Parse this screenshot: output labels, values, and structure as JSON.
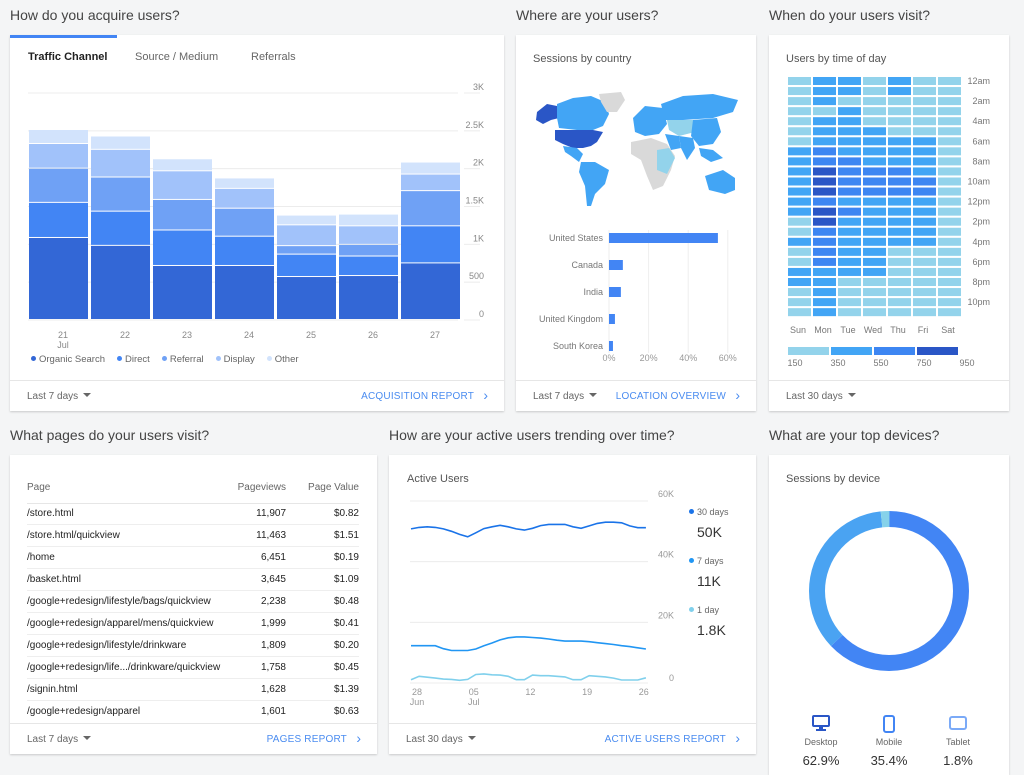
{
  "sections": {
    "acquire": "How do you acquire users?",
    "where": "Where are your users?",
    "when": "When do your users visit?",
    "pages": "What pages do your users visit?",
    "active": "How are your active users trending over time?",
    "devices": "What are your top devices?"
  },
  "acquisition": {
    "tabs": [
      "Traffic Channel",
      "Source / Medium",
      "Referrals"
    ],
    "active_tab": "Traffic Channel",
    "range": "Last 7 days",
    "link": "ACQUISITION REPORT"
  },
  "location": {
    "subtitle": "Sessions by country",
    "range": "Last 7 days",
    "link": "LOCATION OVERVIEW"
  },
  "time": {
    "subtitle": "Users by time of day",
    "range": "Last 30 days"
  },
  "pages": {
    "headers": [
      "Page",
      "Pageviews",
      "Page Value"
    ],
    "rows": [
      [
        "/store.html",
        "11,907",
        "$0.82"
      ],
      [
        "/store.html/quickview",
        "11,463",
        "$1.51"
      ],
      [
        "/home",
        "6,451",
        "$0.19"
      ],
      [
        "/basket.html",
        "3,645",
        "$1.09"
      ],
      [
        "/google+redesign/lifestyle/bags/quickview",
        "2,238",
        "$0.48"
      ],
      [
        "/google+redesign/apparel/mens/quickview",
        "1,999",
        "$0.41"
      ],
      [
        "/google+redesign/lifestyle/drinkware",
        "1,809",
        "$0.20"
      ],
      [
        "/google+redesign/life.../drinkware/quickview",
        "1,758",
        "$0.45"
      ],
      [
        "/signin.html",
        "1,628",
        "$1.39"
      ],
      [
        "/google+redesign/apparel",
        "1,601",
        "$0.63"
      ]
    ],
    "range": "Last 7 days",
    "link": "PAGES REPORT"
  },
  "active": {
    "subtitle": "Active Users",
    "range": "Last 30 days",
    "link": "ACTIVE USERS REPORT",
    "legend": [
      {
        "label": "30 days",
        "value": "50K",
        "color": "#1a73e8"
      },
      {
        "label": "7 days",
        "value": "11K",
        "color": "#2196f3"
      },
      {
        "label": "1 day",
        "value": "1.8K",
        "color": "#80d0ec"
      }
    ]
  },
  "devices": {
    "subtitle": "Sessions by device",
    "items": [
      {
        "label": "Desktop",
        "value": "62.9%",
        "pct": 62.9,
        "color": "#4285f4",
        "icon": "desktop-icon"
      },
      {
        "label": "Mobile",
        "value": "35.4%",
        "pct": 35.4,
        "color": "#4aa3f2",
        "icon": "mobile-icon"
      },
      {
        "label": "Tablet",
        "value": "1.8%",
        "pct": 1.8,
        "color": "#86d2ea",
        "icon": "tablet-icon"
      }
    ]
  },
  "chart_data": [
    {
      "type": "bar",
      "stacked": true,
      "categories": [
        "21",
        "22",
        "23",
        "24",
        "25",
        "26",
        "27"
      ],
      "category_sublabel": "Jul",
      "ylim": [
        0,
        3000
      ],
      "yticks": [
        "0",
        "500",
        "1K",
        "1.5K",
        "2K",
        "2.5K",
        "3K"
      ],
      "grid": true,
      "legend": "bottom",
      "series": [
        {
          "name": "Organic Search",
          "color": "#3367d6",
          "values": [
            1084,
            980,
            714,
            714,
            568,
            581,
            748
          ]
        },
        {
          "name": "Direct",
          "color": "#4285f4",
          "values": [
            464,
            452,
            469,
            387,
            296,
            258,
            490
          ]
        },
        {
          "name": "Referral",
          "color": "#6fa1f5",
          "values": [
            452,
            451,
            404,
            370,
            112,
            154,
            465
          ]
        },
        {
          "name": "Display",
          "color": "#a1c2fa",
          "values": [
            326,
            366,
            378,
            262,
            275,
            245,
            219
          ]
        },
        {
          "name": "Other",
          "color": "#d2e3fc",
          "values": [
            185,
            176,
            159,
            138,
            129,
            155,
            159
          ]
        }
      ]
    },
    {
      "type": "bar",
      "orientation": "horizontal",
      "categories": [
        "United States",
        "Canada",
        "India",
        "United Kingdom",
        "South Korea"
      ],
      "values": [
        55,
        7,
        6,
        3,
        2
      ],
      "xlim": [
        0,
        60
      ],
      "xticks": [
        "0%",
        "20%",
        "40%",
        "60%"
      ],
      "color": "#4285f4"
    },
    {
      "type": "heatmap",
      "columns": [
        "Sun",
        "Mon",
        "Tue",
        "Wed",
        "Thu",
        "Fri",
        "Sat"
      ],
      "row_labels": [
        "12am",
        "",
        "2am",
        "",
        "4am",
        "",
        "6am",
        "",
        "8am",
        "",
        "10am",
        "",
        "12pm",
        "",
        "2pm",
        "",
        "4pm",
        "",
        "6pm",
        "",
        "8pm",
        "",
        "10pm",
        ""
      ],
      "scale_labels": [
        "150",
        "350",
        "550",
        "750",
        "950"
      ],
      "scale_colors": [
        "#93d3eb",
        "#42a5f5",
        "#3d86f2",
        "#2a56c6"
      ],
      "levels": [
        [
          0,
          1,
          1,
          0,
          1,
          0,
          0
        ],
        [
          0,
          1,
          1,
          0,
          1,
          0,
          0
        ],
        [
          0,
          1,
          0,
          0,
          0,
          0,
          0
        ],
        [
          0,
          0,
          1,
          0,
          0,
          0,
          0
        ],
        [
          0,
          1,
          1,
          0,
          0,
          0,
          0
        ],
        [
          0,
          1,
          1,
          1,
          0,
          0,
          0
        ],
        [
          0,
          1,
          1,
          1,
          1,
          1,
          0
        ],
        [
          1,
          2,
          1,
          1,
          1,
          1,
          0
        ],
        [
          1,
          2,
          2,
          1,
          1,
          1,
          0
        ],
        [
          1,
          3,
          2,
          2,
          2,
          1,
          0
        ],
        [
          1,
          3,
          2,
          2,
          2,
          2,
          0
        ],
        [
          1,
          3,
          2,
          2,
          2,
          2,
          0
        ],
        [
          1,
          2,
          1,
          1,
          1,
          1,
          0
        ],
        [
          1,
          3,
          2,
          1,
          1,
          1,
          0
        ],
        [
          0,
          3,
          1,
          1,
          1,
          1,
          0
        ],
        [
          0,
          2,
          1,
          1,
          1,
          1,
          0
        ],
        [
          1,
          2,
          1,
          1,
          1,
          1,
          0
        ],
        [
          0,
          2,
          1,
          1,
          0,
          0,
          0
        ],
        [
          0,
          2,
          1,
          1,
          0,
          0,
          0
        ],
        [
          1,
          1,
          1,
          1,
          0,
          0,
          0
        ],
        [
          1,
          1,
          0,
          0,
          0,
          0,
          0
        ],
        [
          0,
          1,
          0,
          0,
          0,
          0,
          0
        ],
        [
          0,
          1,
          0,
          0,
          0,
          0,
          0
        ],
        [
          0,
          1,
          0,
          0,
          0,
          0,
          0
        ]
      ]
    },
    {
      "type": "line",
      "x_start": "28 Jun",
      "xticks": [
        [
          "28",
          "Jun"
        ],
        [
          "05",
          "Jul"
        ],
        [
          "12",
          ""
        ],
        [
          "19",
          ""
        ],
        [
          "26",
          ""
        ]
      ],
      "ylim": [
        0,
        60000
      ],
      "yticks": [
        "0",
        "20K",
        "40K",
        "60K"
      ],
      "grid": true,
      "series": [
        {
          "name": "30 days",
          "color": "#1a73e8",
          "values": [
            50.8,
            51.3,
            51.5,
            51.3,
            50.8,
            50,
            49,
            48.2,
            49.5,
            50.9,
            51.5,
            52,
            51.5,
            50.8,
            50.4,
            51,
            51.9,
            52.3,
            52.3,
            52.3,
            51.5,
            51,
            51.8,
            52.6,
            53,
            53,
            52.8,
            51.8,
            51.2,
            51.2
          ]
        },
        {
          "name": "7 days",
          "color": "#2196f3",
          "values": [
            12.3,
            12.3,
            12.3,
            12.3,
            11.3,
            10.7,
            10.7,
            10.7,
            11.2,
            12.3,
            13.2,
            14.2,
            14.9,
            15.2,
            15.2,
            15,
            14.8,
            14.5,
            14.1,
            13.8,
            13.8,
            13.8,
            13.6,
            13.3,
            13,
            12.7,
            12.3,
            12,
            11.6,
            11.2
          ]
        },
        {
          "name": "1 day",
          "color": "#80d0ec",
          "values": [
            1.1,
            2.2,
            1.9,
            1.6,
            1.3,
            1.2,
            0.9,
            1.2,
            2.8,
            3.0,
            2.7,
            2.6,
            2.2,
            1.1,
            1.1,
            2.6,
            2.4,
            2.4,
            2.2,
            2.0,
            1.1,
            1.1,
            2.4,
            2.2,
            2.0,
            1.6,
            1.0,
            1.0,
            1.0,
            1.7
          ]
        }
      ],
      "value_unit": "K"
    },
    {
      "type": "pie",
      "donut": true,
      "categories": [
        "Desktop",
        "Mobile",
        "Tablet"
      ],
      "values": [
        62.9,
        35.4,
        1.8
      ]
    }
  ]
}
